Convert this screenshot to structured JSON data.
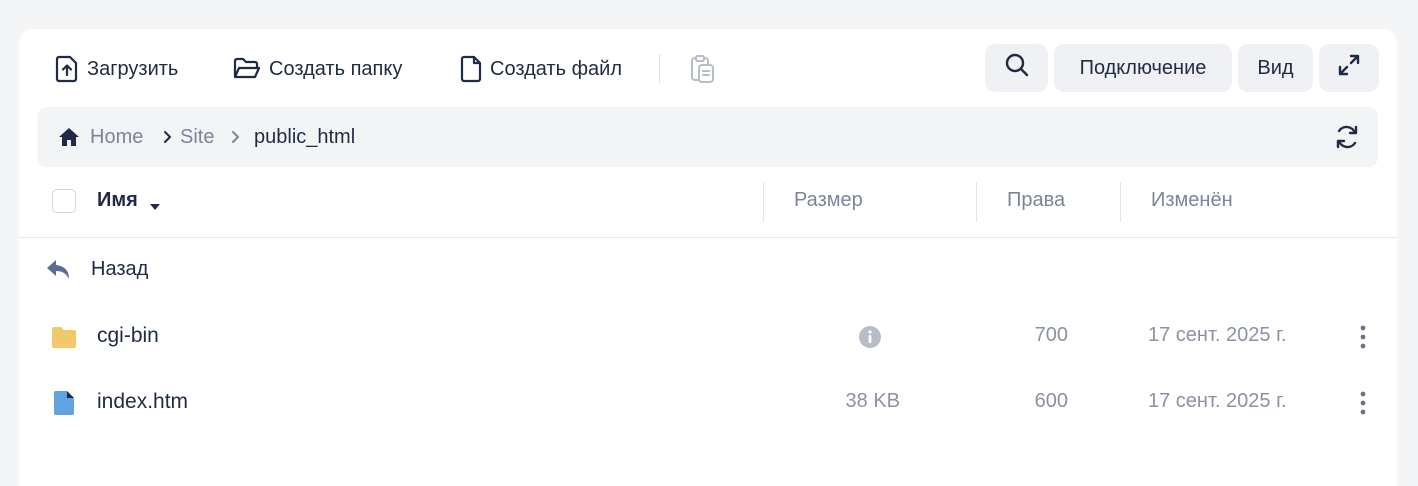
{
  "toolbar": {
    "upload_label": "Загрузить",
    "new_folder_label": "Создать папку",
    "new_file_label": "Создать файл",
    "paste_icon": "clipboard-icon",
    "search_icon": "search-icon",
    "connect_label": "Подключение",
    "view_label": "Вид",
    "expand_icon": "expand-icon"
  },
  "breadcrumb": {
    "items": [
      "Home",
      "Site",
      "public_html"
    ]
  },
  "table": {
    "columns": {
      "name": "Имя",
      "size": "Размер",
      "perms": "Права",
      "modified": "Изменён"
    },
    "back_label": "Назад",
    "rows": [
      {
        "name": "cgi-bin",
        "type": "folder",
        "size": "",
        "perms": "700",
        "modified": "17 сент. 2025 г."
      },
      {
        "name": "index.htm",
        "type": "file",
        "size": "38 KB",
        "perms": "600",
        "modified": "17 сент. 2025 г."
      }
    ]
  },
  "colors": {
    "accent_text": "#1f2a44",
    "muted_text": "#7c8598",
    "folder": "#f0c96a",
    "file": "#5fa3e0",
    "back_icon": "#5a6d9a"
  }
}
